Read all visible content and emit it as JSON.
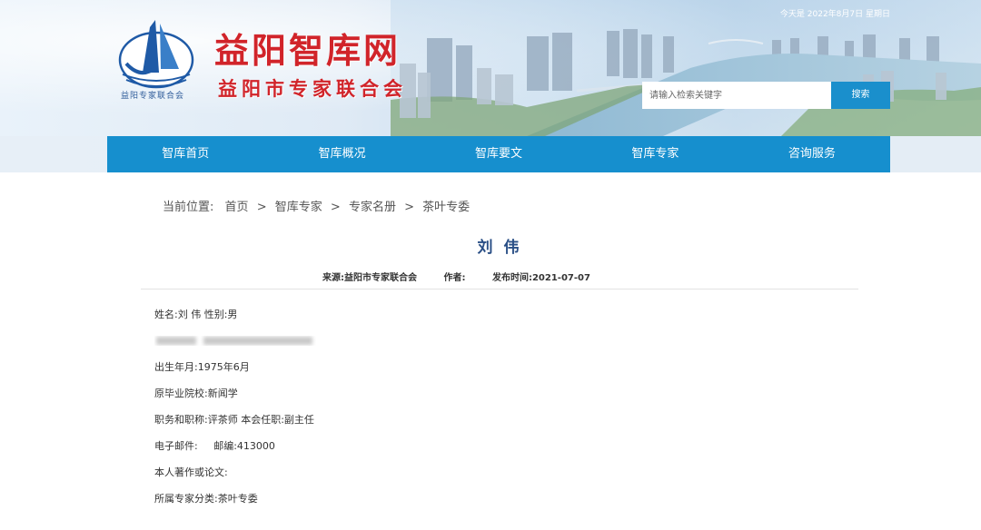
{
  "header": {
    "date_text": "今天是 2022年8月7日 星期日",
    "logo_caption": "益阳专家联合会",
    "site_title": "益阳智库网",
    "site_subtitle": "益阳市专家联合会",
    "search_placeholder": "请输入检索关键字",
    "search_button": "搜索"
  },
  "nav": {
    "items": [
      "智库首页",
      "智库概况",
      "智库要文",
      "智库专家",
      "咨询服务"
    ]
  },
  "breadcrumb": {
    "label": "当前位置:",
    "items": [
      "首页",
      "智库专家",
      "专家名册",
      "茶叶专委"
    ],
    "separator": ">"
  },
  "article": {
    "title": "刘 伟",
    "source": "来源:益阳市专家联合会",
    "author": "作者:",
    "publish_time": "发布时间:2021-07-07",
    "fields": {
      "name_gender": "姓名:刘 伟 性别:男",
      "birth": "出生年月:1975年6月",
      "school": "原毕业院校:新闻学",
      "position": "职务和职称:评茶师 本会任职:副主任",
      "email": "电子邮件:     邮编:413000",
      "works": "本人著作或论文:",
      "category": "所属专家分类:茶叶专委"
    }
  },
  "colors": {
    "nav_bg": "#168fce",
    "title_red": "#d1242a",
    "article_title": "#2a4f86",
    "search_button": "#1a8fcc"
  }
}
